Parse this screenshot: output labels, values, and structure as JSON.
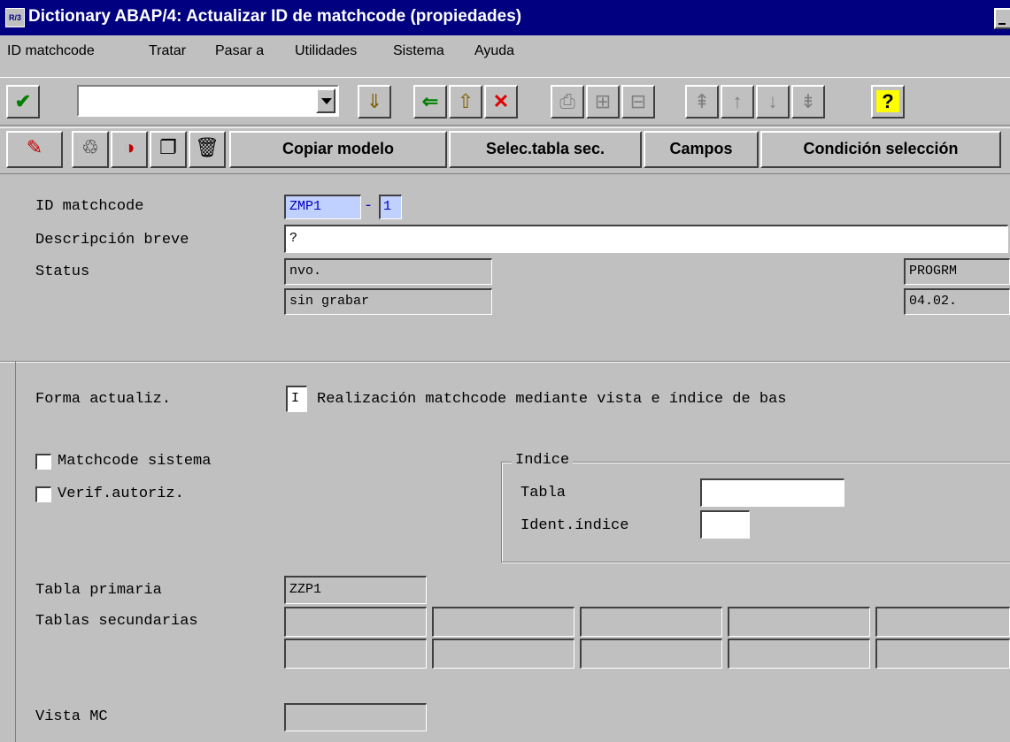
{
  "window": {
    "title": "Dictionary ABAP/4: Actualizar ID de matchcode (propiedades)",
    "icon_text": "R/3"
  },
  "menu": [
    "ID matchcode",
    "Tratar",
    "Pasar a",
    "Utilidades",
    "Sistema",
    "Ayuda"
  ],
  "toolbar1": {
    "command_field_value": "",
    "icons": [
      "check-icon",
      "save-icon",
      "back-icon",
      "exit-icon",
      "cancel-icon",
      "print-icon",
      "find-icon",
      "find-next-icon",
      "first-page-icon",
      "previous-page-icon",
      "next-page-icon",
      "last-page-icon",
      "help-icon"
    ],
    "help_glyph": "?"
  },
  "toolbar2": {
    "icons": [
      "display-change-icon",
      "hierarchy-icon",
      "activate-icon",
      "copy-icon",
      "delete-icon"
    ],
    "buttons": [
      "Copiar modelo",
      "Selec.tabla sec.",
      "Campos",
      "Condición selección"
    ]
  },
  "header": {
    "id_label": "ID matchcode",
    "id_value": "ZMP1",
    "id_sep": "-",
    "id_sub": "1",
    "desc_label": "Descripción breve",
    "desc_value": "?",
    "status_label": "Status",
    "status_value1": "nvo.",
    "status_value2": "sin grabar",
    "right_value1": "PROGRM",
    "right_value2": "04.02."
  },
  "options": {
    "forma_label": "Forma actualiz.",
    "forma_value": "I",
    "forma_desc": "Realización matchcode mediante vista e índice de bas",
    "matchcode_sistema_label": "Matchcode sistema",
    "matchcode_sistema_checked": false,
    "verif_autoriz_label": "Verif.autoriz.",
    "verif_autoriz_checked": false,
    "indice_title": "Indice",
    "tabla_label": "Tabla",
    "tabla_value": "",
    "ident_indice_label": "Ident.índice",
    "ident_indice_value": ""
  },
  "tables": {
    "primaria_label": "Tabla primaria",
    "primaria_value": "ZZP1",
    "secundarias_label": "Tablas secundarias",
    "secundarias_row1": [
      "",
      "",
      "",
      "",
      ""
    ],
    "secundarias_row2": [
      "",
      "",
      "",
      "",
      ""
    ],
    "vista_label": "Vista MC",
    "vista_value": ""
  },
  "colors": {
    "titlebar": "#000080",
    "window_bg": "#c0c0c0",
    "key_field_bg": "#c0d0ff",
    "key_field_text": "#0000c0"
  }
}
